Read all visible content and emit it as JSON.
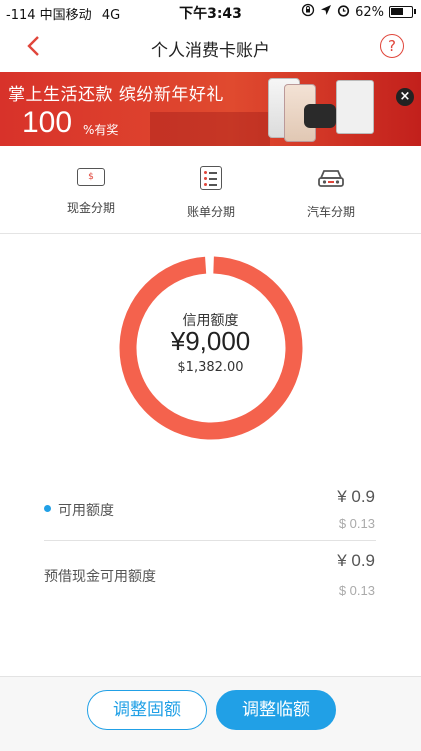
{
  "status": {
    "signal": "-114",
    "carrier": "中国移动",
    "network": "4G",
    "time": "下午3:43",
    "battery": "62%",
    "battery_level": 0.62
  },
  "nav": {
    "title": "个人消费卡账户",
    "help_label": "?"
  },
  "banner": {
    "tagline": "掌上生活还款  缤纷新年好礼",
    "number": "100",
    "suffix": "%有奖",
    "close_label": "×"
  },
  "menu": {
    "items": [
      {
        "label": "现金分期",
        "icon": "cash-icon",
        "glyph": "$"
      },
      {
        "label": "账单分期",
        "icon": "bill-icon"
      },
      {
        "label": "汽车分期",
        "icon": "car-icon"
      }
    ]
  },
  "credit": {
    "label": "信用额度",
    "amount": "¥9,000",
    "usd": "$1,382.00",
    "ring_color": "#f4624d",
    "used_fraction": 0.0
  },
  "rows": [
    {
      "label": "可用额度",
      "value": "¥ 0.9",
      "sub": "$ 0.13",
      "dot_color": "#21a0e6"
    },
    {
      "label": "预借现金可用额度",
      "value": "¥ 0.9",
      "sub": "$ 0.13"
    }
  ],
  "buttons": {
    "adjust_fixed": "调整固额",
    "adjust_temp": "调整临额"
  },
  "colors": {
    "accent_red": "#e0463b",
    "accent_blue": "#21a0e6"
  }
}
